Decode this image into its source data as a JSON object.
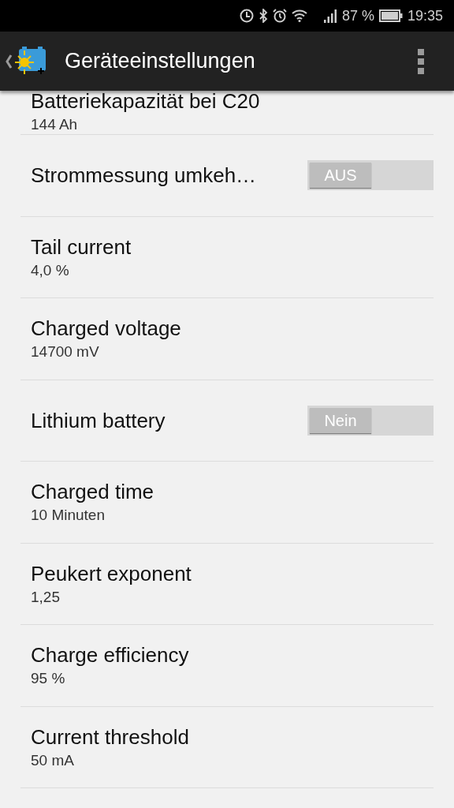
{
  "status_bar": {
    "battery_percent": "87 %",
    "time": "19:35"
  },
  "header": {
    "title": "Geräteeinstellungen"
  },
  "rows": [
    {
      "kind": "value",
      "title": "Batteriekapazität bei C20",
      "value": "144 Ah"
    },
    {
      "kind": "toggle",
      "title": "Strommessung umkeh…",
      "switch_label": "AUS",
      "on": false
    },
    {
      "kind": "value",
      "title": "Tail current",
      "value": "4,0 %"
    },
    {
      "kind": "value",
      "title": "Charged voltage",
      "value": "14700 mV"
    },
    {
      "kind": "toggle",
      "title": "Lithium battery",
      "switch_label": "Nein",
      "on": false
    },
    {
      "kind": "value",
      "title": "Charged time",
      "value": "10 Minuten"
    },
    {
      "kind": "value",
      "title": "Peukert exponent",
      "value": "1,25"
    },
    {
      "kind": "value",
      "title": "Charge efficiency",
      "value": "95 %"
    },
    {
      "kind": "value",
      "title": "Current threshold",
      "value": "50 mA"
    }
  ]
}
